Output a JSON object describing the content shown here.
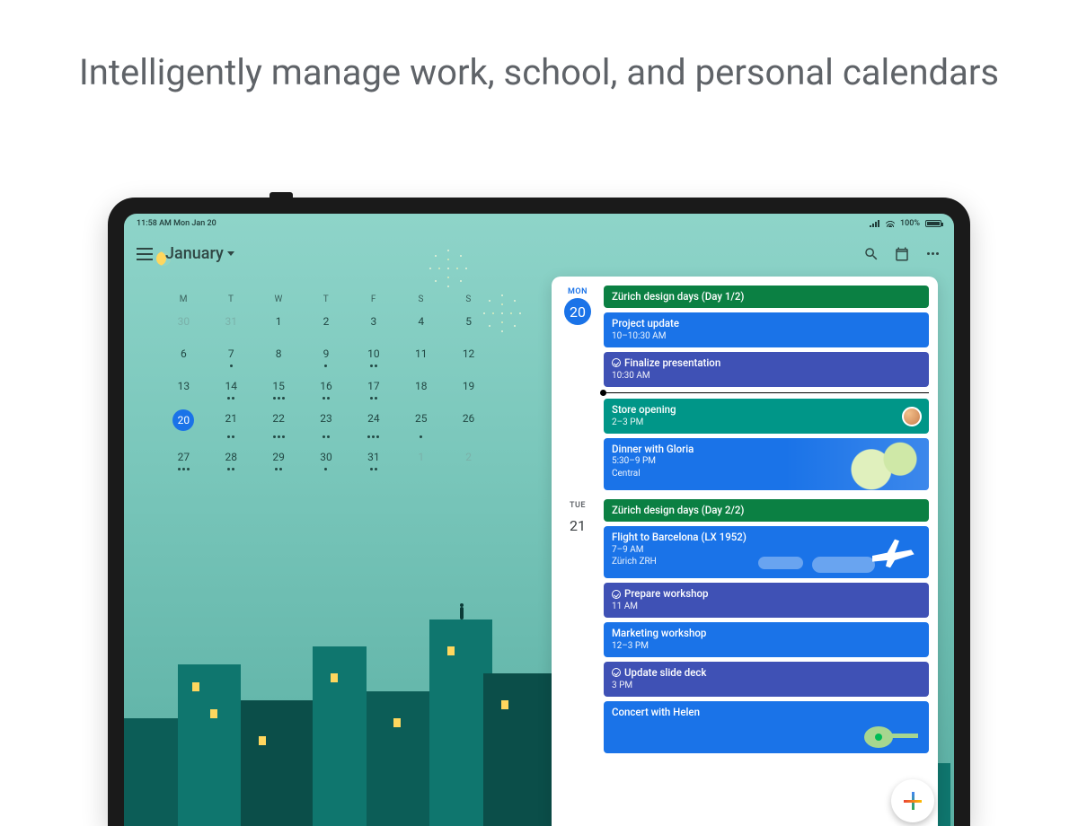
{
  "headline": "Intelligently manage work, school, and personal calendars",
  "statusbar": {
    "left": "11:58 AM  Mon Jan 20",
    "battery": "100%"
  },
  "header": {
    "month": "January"
  },
  "mini_calendar": {
    "weekdays": [
      "M",
      "T",
      "W",
      "T",
      "F",
      "S",
      "S"
    ],
    "weeks": [
      [
        {
          "n": "30",
          "muted": true
        },
        {
          "n": "31",
          "muted": true
        },
        {
          "n": "1"
        },
        {
          "n": "2"
        },
        {
          "n": "3"
        },
        {
          "n": "4"
        },
        {
          "n": "5"
        }
      ],
      [
        {
          "n": "6"
        },
        {
          "n": "7",
          "dots": 1
        },
        {
          "n": "8"
        },
        {
          "n": "9",
          "dots": 1
        },
        {
          "n": "10",
          "dots": 2
        },
        {
          "n": "11"
        },
        {
          "n": "12"
        }
      ],
      [
        {
          "n": "13"
        },
        {
          "n": "14",
          "dots": 2
        },
        {
          "n": "15",
          "dots": 3
        },
        {
          "n": "16",
          "dots": 2
        },
        {
          "n": "17",
          "dots": 2
        },
        {
          "n": "18"
        },
        {
          "n": "19"
        }
      ],
      [
        {
          "n": "20",
          "today": true
        },
        {
          "n": "21",
          "dots": 2
        },
        {
          "n": "22",
          "dots": 3
        },
        {
          "n": "23",
          "dots": 2
        },
        {
          "n": "24",
          "dots": 3
        },
        {
          "n": "25",
          "dots": 1
        },
        {
          "n": "26"
        }
      ],
      [
        {
          "n": "27",
          "dots": 3
        },
        {
          "n": "28",
          "dots": 2
        },
        {
          "n": "29",
          "dots": 2
        },
        {
          "n": "30",
          "dots": 1
        },
        {
          "n": "31",
          "dots": 2
        },
        {
          "n": "1",
          "muted": true
        },
        {
          "n": "2",
          "muted": true
        }
      ]
    ]
  },
  "agenda": {
    "days": [
      {
        "weekday": "MON",
        "num": "20",
        "active": true,
        "events": [
          {
            "color": "green",
            "title": "Zürich design days (Day 1/2)"
          },
          {
            "color": "blue",
            "title": "Project update",
            "sub": "10–10:30 AM"
          },
          {
            "color": "navy",
            "title": "Finalize presentation",
            "sub": "10:30 AM",
            "task": true,
            "now_after": true
          },
          {
            "color": "teal",
            "title": "Store opening",
            "sub": "2–3 PM",
            "avatar": true
          },
          {
            "color": "blue",
            "title": "Dinner with Gloria",
            "sub": "5:30–9 PM",
            "sub2": "Central",
            "big": true,
            "food": true
          }
        ]
      },
      {
        "weekday": "TUE",
        "num": "21",
        "active": false,
        "events": [
          {
            "color": "green",
            "title": "Zürich design days (Day 2/2)"
          },
          {
            "color": "blue",
            "title": "Flight to Barcelona (LX 1952)",
            "sub": "7–9 AM",
            "sub2": "Zürich ZRH",
            "big": true,
            "plane": true
          },
          {
            "color": "navy",
            "title": "Prepare workshop",
            "sub": "11 AM",
            "task": true
          },
          {
            "color": "blue",
            "title": "Marketing workshop",
            "sub": "12–3 PM"
          },
          {
            "color": "navy",
            "title": "Update slide deck",
            "sub": "3 PM",
            "task": true
          },
          {
            "color": "blue",
            "title": "Concert with Helen",
            "sub": "",
            "big": true,
            "guitar": true
          }
        ]
      }
    ]
  }
}
